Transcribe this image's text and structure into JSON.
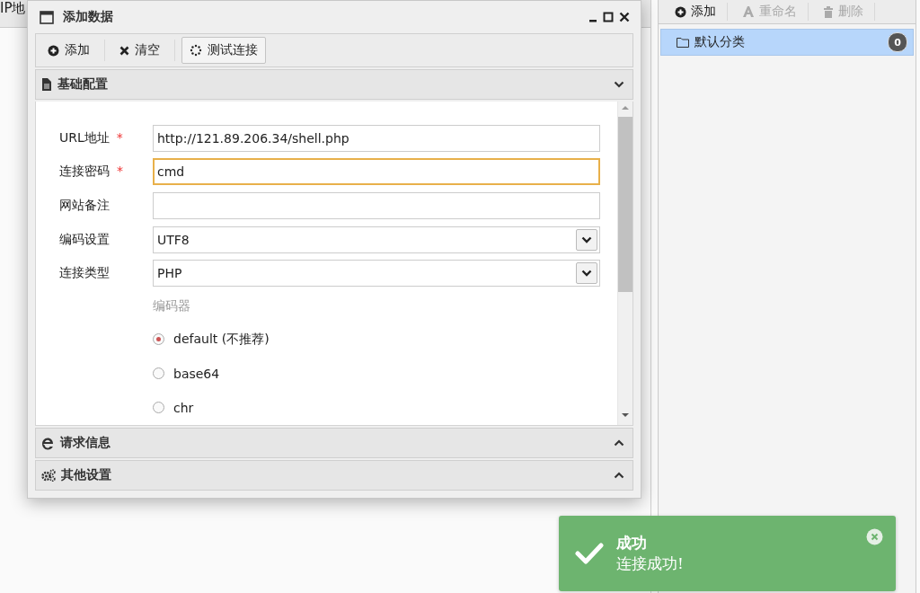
{
  "background": {
    "header_text": "IP地"
  },
  "category_panel": {
    "toolbar": [
      {
        "label": "添加",
        "disabled": false
      },
      {
        "label": "重命名",
        "disabled": true
      },
      {
        "label": "删除",
        "disabled": true
      }
    ],
    "items": [
      {
        "label": "默认分类",
        "count": "0",
        "selected": true
      }
    ]
  },
  "dialog": {
    "title": "添加数据",
    "toolbar": [
      {
        "label": "添加",
        "pressed": false
      },
      {
        "label": "清空",
        "pressed": false
      },
      {
        "label": "测试连接",
        "pressed": true
      }
    ],
    "sections": [
      {
        "title": "基础配置",
        "expanded": true,
        "fields": [
          {
            "kind": "text",
            "label": "URL地址",
            "required_mark": "*",
            "focused": false,
            "value": "http://121.89.206.34/shell.php"
          },
          {
            "kind": "text",
            "label": "连接密码",
            "required_mark": "*",
            "focused": true,
            "value": "cmd"
          },
          {
            "kind": "text",
            "label": "网站备注",
            "focused": false
          },
          {
            "kind": "select",
            "label": "编码设置",
            "value": "UTF8"
          },
          {
            "kind": "select",
            "label": "连接类型",
            "value": "PHP"
          },
          {
            "kind": "radio_group",
            "label": "编码器",
            "options": [
              {
                "label": "default (不推荐)",
                "selected": true
              },
              {
                "label": "base64",
                "selected": false
              },
              {
                "label": "chr",
                "selected": false
              }
            ]
          }
        ]
      },
      {
        "title": "请求信息",
        "expanded": false
      },
      {
        "title": "其他设置",
        "expanded": false
      }
    ]
  },
  "toast": {
    "title": "成功",
    "message": "连接成功!"
  }
}
